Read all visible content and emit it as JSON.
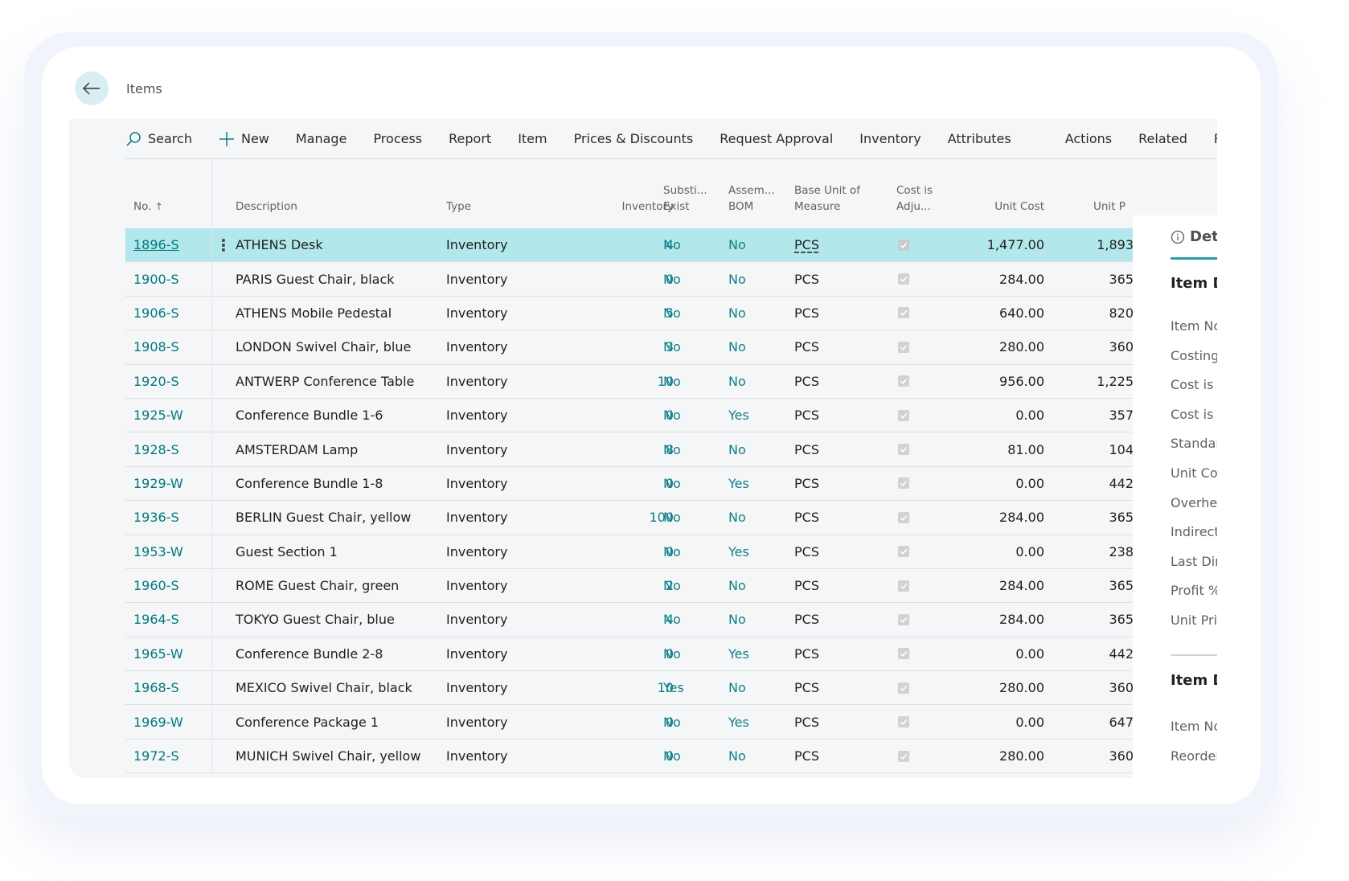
{
  "page": {
    "title": "Items",
    "back_label": "Back"
  },
  "toolbar": {
    "items": [
      {
        "label": "Search",
        "icon": "search-icon"
      },
      {
        "label": "New",
        "icon": "plus-icon"
      },
      {
        "label": "Manage"
      },
      {
        "label": "Process"
      },
      {
        "label": "Report"
      },
      {
        "label": "Item"
      },
      {
        "label": "Prices & Discounts"
      },
      {
        "label": "Request Approval"
      },
      {
        "label": "Inventory"
      },
      {
        "label": "Attributes"
      }
    ],
    "secondary": [
      {
        "label": "Actions"
      },
      {
        "label": "Related"
      },
      {
        "label": "Repo"
      }
    ]
  },
  "table": {
    "headers": {
      "no": "No.",
      "sort_indicator": "↑",
      "description": "Description",
      "type": "Type",
      "inventory": "Inventory",
      "substitutes_1": "Substi...",
      "substitutes_2": "Exist",
      "assembly_1": "Assem...",
      "assembly_2": "BOM",
      "base_unit_1": "Base Unit of",
      "base_unit_2": "Measure",
      "cost_adj_1": "Cost is",
      "cost_adj_2": "Adju...",
      "unit_cost": "Unit Cost",
      "unit_price": "Unit P"
    },
    "rows": [
      {
        "no": "1896-S",
        "description": "ATHENS Desk",
        "type": "Inventory",
        "inventory": "4",
        "substitutes": "No",
        "assembly_bom": "No",
        "base_unit": "PCS",
        "cost_adjusted": true,
        "unit_cost": "1,477.00",
        "unit_price": "1,893",
        "selected": true
      },
      {
        "no": "1900-S",
        "description": "PARIS Guest Chair, black",
        "type": "Inventory",
        "inventory": "0",
        "substitutes": "No",
        "assembly_bom": "No",
        "base_unit": "PCS",
        "cost_adjusted": true,
        "unit_cost": "284.00",
        "unit_price": "365"
      },
      {
        "no": "1906-S",
        "description": "ATHENS Mobile Pedestal",
        "type": "Inventory",
        "inventory": "5",
        "substitutes": "No",
        "assembly_bom": "No",
        "base_unit": "PCS",
        "cost_adjusted": true,
        "unit_cost": "640.00",
        "unit_price": "820"
      },
      {
        "no": "1908-S",
        "description": "LONDON Swivel Chair, blue",
        "type": "Inventory",
        "inventory": "3",
        "substitutes": "No",
        "assembly_bom": "No",
        "base_unit": "PCS",
        "cost_adjusted": true,
        "unit_cost": "280.00",
        "unit_price": "360"
      },
      {
        "no": "1920-S",
        "description": "ANTWERP Conference Table",
        "type": "Inventory",
        "inventory": "10",
        "substitutes": "No",
        "assembly_bom": "No",
        "base_unit": "PCS",
        "cost_adjusted": true,
        "unit_cost": "956.00",
        "unit_price": "1,225"
      },
      {
        "no": "1925-W",
        "description": "Conference Bundle 1-6",
        "type": "Inventory",
        "inventory": "0",
        "substitutes": "No",
        "assembly_bom": "Yes",
        "base_unit": "PCS",
        "cost_adjusted": true,
        "unit_cost": "0.00",
        "unit_price": "357"
      },
      {
        "no": "1928-S",
        "description": "AMSTERDAM Lamp",
        "type": "Inventory",
        "inventory": "8",
        "substitutes": "No",
        "assembly_bom": "No",
        "base_unit": "PCS",
        "cost_adjusted": true,
        "unit_cost": "81.00",
        "unit_price": "104"
      },
      {
        "no": "1929-W",
        "description": "Conference Bundle 1-8",
        "type": "Inventory",
        "inventory": "0",
        "substitutes": "No",
        "assembly_bom": "Yes",
        "base_unit": "PCS",
        "cost_adjusted": true,
        "unit_cost": "0.00",
        "unit_price": "442"
      },
      {
        "no": "1936-S",
        "description": "BERLIN Guest Chair, yellow",
        "type": "Inventory",
        "inventory": "100",
        "substitutes": "No",
        "assembly_bom": "No",
        "base_unit": "PCS",
        "cost_adjusted": true,
        "unit_cost": "284.00",
        "unit_price": "365"
      },
      {
        "no": "1953-W",
        "description": "Guest Section 1",
        "type": "Inventory",
        "inventory": "0",
        "substitutes": "No",
        "assembly_bom": "Yes",
        "base_unit": "PCS",
        "cost_adjusted": true,
        "unit_cost": "0.00",
        "unit_price": "238"
      },
      {
        "no": "1960-S",
        "description": "ROME Guest Chair, green",
        "type": "Inventory",
        "inventory": "2",
        "substitutes": "No",
        "assembly_bom": "No",
        "base_unit": "PCS",
        "cost_adjusted": true,
        "unit_cost": "284.00",
        "unit_price": "365"
      },
      {
        "no": "1964-S",
        "description": "TOKYO Guest Chair, blue",
        "type": "Inventory",
        "inventory": "4",
        "substitutes": "No",
        "assembly_bom": "No",
        "base_unit": "PCS",
        "cost_adjusted": true,
        "unit_cost": "284.00",
        "unit_price": "365"
      },
      {
        "no": "1965-W",
        "description": "Conference Bundle 2-8",
        "type": "Inventory",
        "inventory": "0",
        "substitutes": "No",
        "assembly_bom": "Yes",
        "base_unit": "PCS",
        "cost_adjusted": true,
        "unit_cost": "0.00",
        "unit_price": "442"
      },
      {
        "no": "1968-S",
        "description": "MEXICO Swivel Chair, black",
        "type": "Inventory",
        "inventory": "10",
        "substitutes": "Yes",
        "assembly_bom": "No",
        "base_unit": "PCS",
        "cost_adjusted": true,
        "unit_cost": "280.00",
        "unit_price": "360"
      },
      {
        "no": "1969-W",
        "description": "Conference Package 1",
        "type": "Inventory",
        "inventory": "0",
        "substitutes": "No",
        "assembly_bom": "Yes",
        "base_unit": "PCS",
        "cost_adjusted": true,
        "unit_cost": "0.00",
        "unit_price": "647"
      },
      {
        "no": "1972-S",
        "description": "MUNICH Swivel Chair, yellow",
        "type": "Inventory",
        "inventory": "0",
        "substitutes": "No",
        "assembly_bom": "No",
        "base_unit": "PCS",
        "cost_adjusted": true,
        "unit_cost": "280.00",
        "unit_price": "360"
      }
    ]
  },
  "detail_panel": {
    "tab_label": "Deta",
    "section1_heading": "Item D",
    "section1_fields": [
      "Item No",
      "Costing",
      "Cost is A",
      "Cost is P",
      "Standard",
      "Unit Cos",
      "Overhea",
      "Indirect",
      "Last Dire",
      "Profit %",
      "Unit Pric"
    ],
    "section2_heading": "Item D",
    "section2_fields": [
      "Item No",
      "Reorderi"
    ]
  },
  "colors": {
    "accent": "#00787e",
    "selected_row": "#b2e8eb",
    "content_bg": "#f5f6f8",
    "frame_bg": "#f1f4fb"
  }
}
